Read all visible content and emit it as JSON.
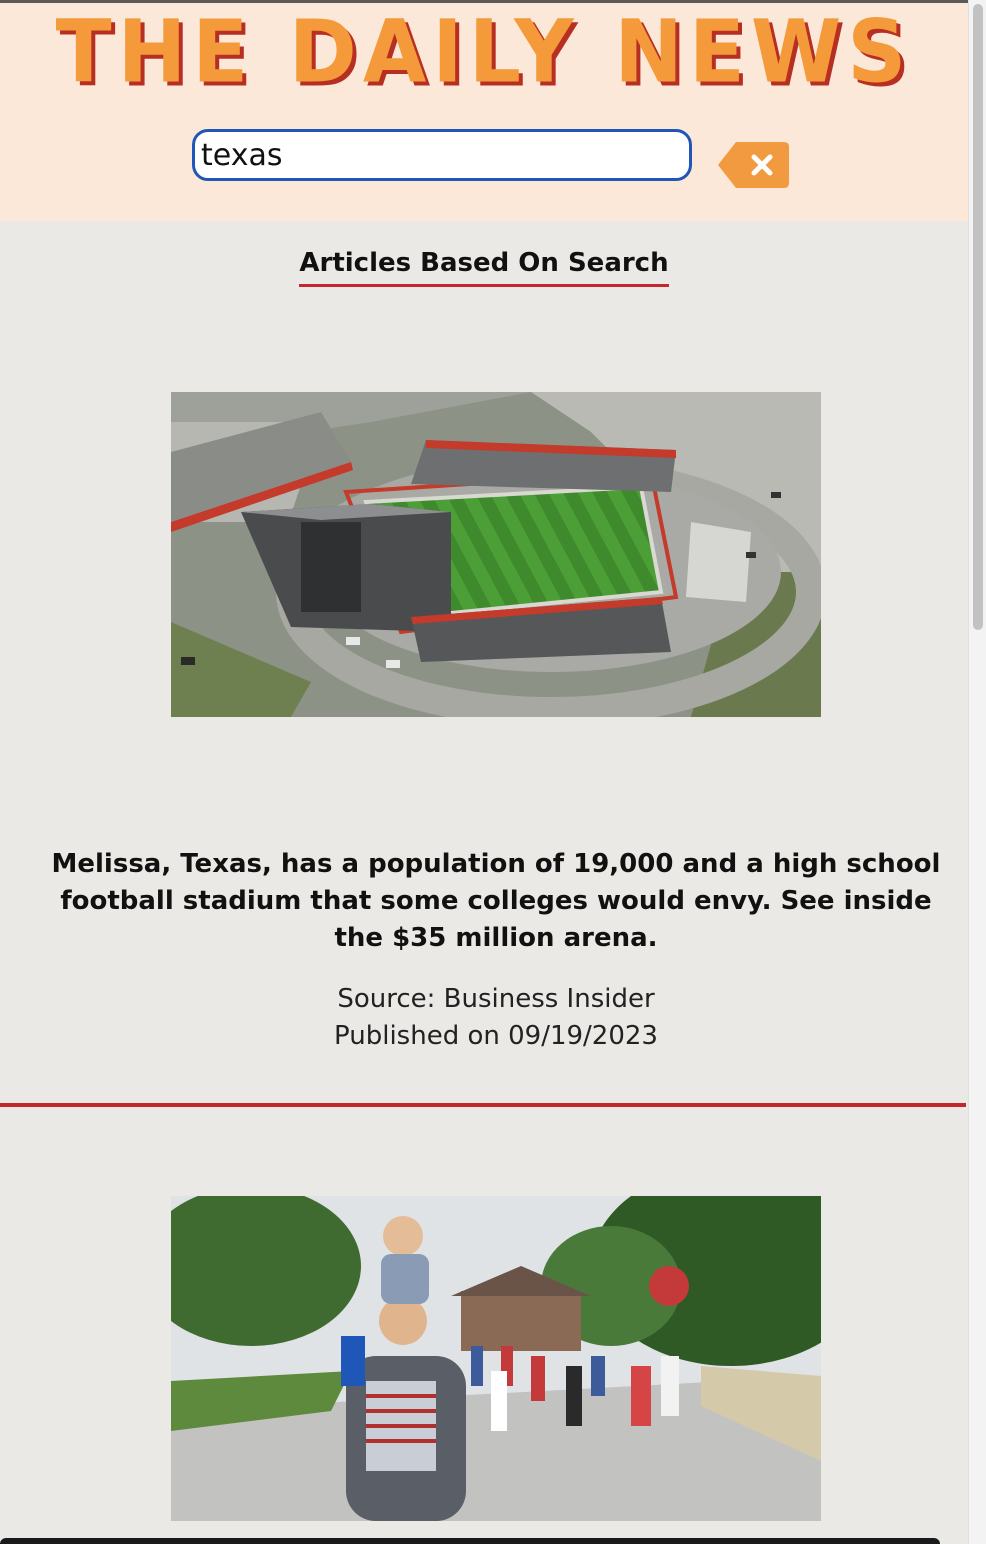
{
  "header": {
    "logo_text": "THE DAILY NEWS",
    "search_value": "texas",
    "clear_icon": "clear-backspace-icon"
  },
  "main": {
    "section_title": "Articles Based On Search",
    "articles": [
      {
        "image_alt": "Aerial view of high school football stadium",
        "title": "Melissa, Texas, has a population of 19,000 and a high school football stadium that some colleges would envy. See inside the $35 million arena.",
        "source": "Source: Business Insider",
        "published": "Published on 09/19/2023"
      },
      {
        "image_alt": "Man carrying child on shoulders at Fourth of July parade"
      }
    ]
  },
  "colors": {
    "header_bg": "#fbe8d8",
    "logo": "#f59a3a",
    "logo_shadow": "#b72e22",
    "accent_red": "#c2272d",
    "input_border": "#1f56b8",
    "clear_button": "#f29a3f",
    "page_bg": "#ebe9e5"
  }
}
